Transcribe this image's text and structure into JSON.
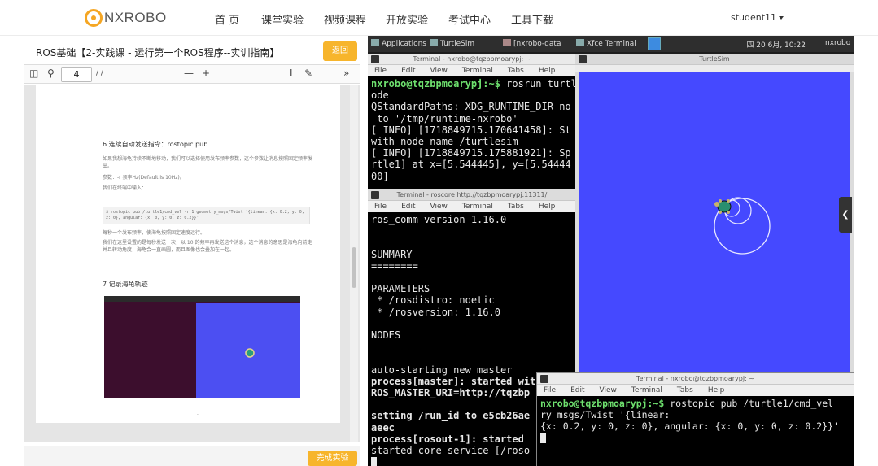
{
  "brand": {
    "logo_text": "NXROBO",
    "accent_color": "#f7b52c"
  },
  "nav": {
    "items": [
      "首 页",
      "课堂实验",
      "视频课程",
      "开放实验",
      "考试中心",
      "工具下载"
    ],
    "user": "student11"
  },
  "course": {
    "title": "ROS基础【2-实践课 - 运行第一个ROS程序--实训指南】",
    "back_label": "返回",
    "finish_label": "完成实验"
  },
  "pdf": {
    "page_number": "4",
    "page_total_sep": "/ /",
    "zoom_minus": "—",
    "zoom_plus": "+",
    "collapse_icon": "»",
    "heading_6": "6  连续自动发送指令：rostopic pub",
    "para_6a": "如果我想海龟持续不断地移动，我们可以选择使用发布频率参数，这个参数让消息按照固定频率发出。",
    "para_6b": "参数：-r 频率Hz(Default is 10Hz)。",
    "para_6c": "我们在终端中输入：",
    "code_6": "$ rostopic pub /turtle1/cmd_vel -r 1 geometry_msgs/Twist '{linear: {x: 0.2, y: 0, z: 0}, angular: {x: 0, y: 0, z: 0.2}}'",
    "para_6d": "每秒一个发布频率，使海龟按照固定速度运行。",
    "para_6e": "我们在这里设置的是每秒发送一次，以 10 的频率再发送这个消息，这个消息的意思是海龟向前走并且转动角度，海龟会一直画圆，而且图像也会叠加在一起。",
    "heading_7": "7  记录海龟轨迹",
    "dot": "·"
  },
  "desktop": {
    "panel": {
      "applications": "Applications",
      "task1": "TurtleSim",
      "task2": "[nxrobo-data",
      "task3": "Xfce Terminal",
      "clock": "四 20 6月, 10:22",
      "host": "nxrobo"
    },
    "menu": [
      "File",
      "Edit",
      "View",
      "Terminal",
      "Tabs",
      "Help"
    ],
    "term1": {
      "title": "Terminal - nxrobo@tqzbpmoarypj: ~",
      "prompt": "nxrobo@tqzbpmoarypj:~$",
      "cmd": " rosrun turtl",
      "lines": [
        "ode",
        "QStandardPaths: XDG_RUNTIME_DIR no",
        " to '/tmp/runtime-nxrobo'",
        "[ INFO] [1718849715.170641458]: St",
        "with node name /turtlesim",
        "[ INFO] [1718849715.175881921]: Sp",
        "rtle1] at x=[5.544445], y=[5.54444",
        "00]"
      ]
    },
    "term2": {
      "title": "Terminal - roscore http://tqzbpmoarypj:11311/",
      "line_version": "ros_comm version 1.16.0",
      "summary": "SUMMARY",
      "rule": "========",
      "parameters": "PARAMETERS",
      "param1": " * /rosdistro: noetic",
      "param2": " * /rosversion: 1.16.0",
      "nodes": "NODES",
      "auto": "auto-starting new master",
      "process_master": "process[master]: started with",
      "master_uri": "ROS_MASTER_URI=http://tqzbp",
      "setting": "setting /run_id to e5cb26ae",
      "aeec": "aeec",
      "rosout": "process[rosout-1]: started",
      "core": "started core service [/roso"
    },
    "turtlesim": {
      "title": "TurtleSim",
      "bg_color": "#4549ff"
    },
    "term3": {
      "title": "Terminal - nxrobo@tqzbpmoarypj: ~",
      "prompt": "nxrobo@tqzbpmoarypj:~$",
      "cmd": " rostopic pub /turtle1/cmd_vel",
      "line2": "ry_msgs/Twist '{linear:",
      "line3": "{x: 0.2, y: 0, z: 0}, angular: {x: 0, y: 0, z: 0.2}}'"
    }
  }
}
